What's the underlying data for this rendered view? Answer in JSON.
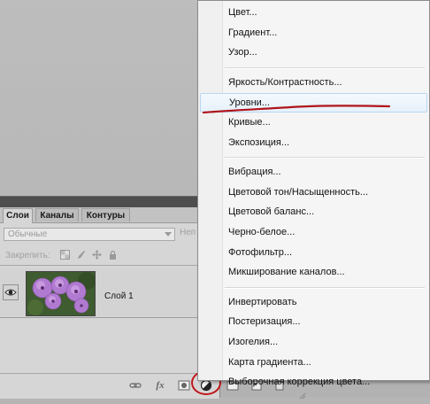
{
  "panel": {
    "tabs": [
      "Слои",
      "Каналы",
      "Контуры"
    ],
    "active_tab": "Слои",
    "blend_mode": "Обычные",
    "opacity_label": "Неп",
    "lock_label": "Закрепить:",
    "layer": {
      "name": "Слой 1"
    },
    "bottom_icons": [
      "link-icon",
      "fx-icon",
      "mask-icon",
      "adjustment-layer-icon",
      "folder-icon",
      "new-layer-icon",
      "trash-icon"
    ],
    "fx_label": "fx"
  },
  "menu": {
    "groups": [
      [
        "Цвет...",
        "Градиент...",
        "Узор..."
      ],
      [
        "Яркость/Контрастность...",
        "Уровни...",
        "Кривые...",
        "Экспозиция..."
      ],
      [
        "Вибрация...",
        "Цветовой тон/Насыщенность...",
        "Цветовой баланс...",
        "Черно-белое...",
        "Фотофильтр...",
        "Микширование каналов..."
      ],
      [
        "Инвертировать",
        "Постеризация...",
        "Изогелия...",
        "Карта градиента...",
        "Выборочная коррекция цвета..."
      ]
    ],
    "highlighted": "Уровни..."
  },
  "colors": {
    "annotation_red": "#c0161a",
    "menu_hover_border": "#b8d6f0"
  }
}
